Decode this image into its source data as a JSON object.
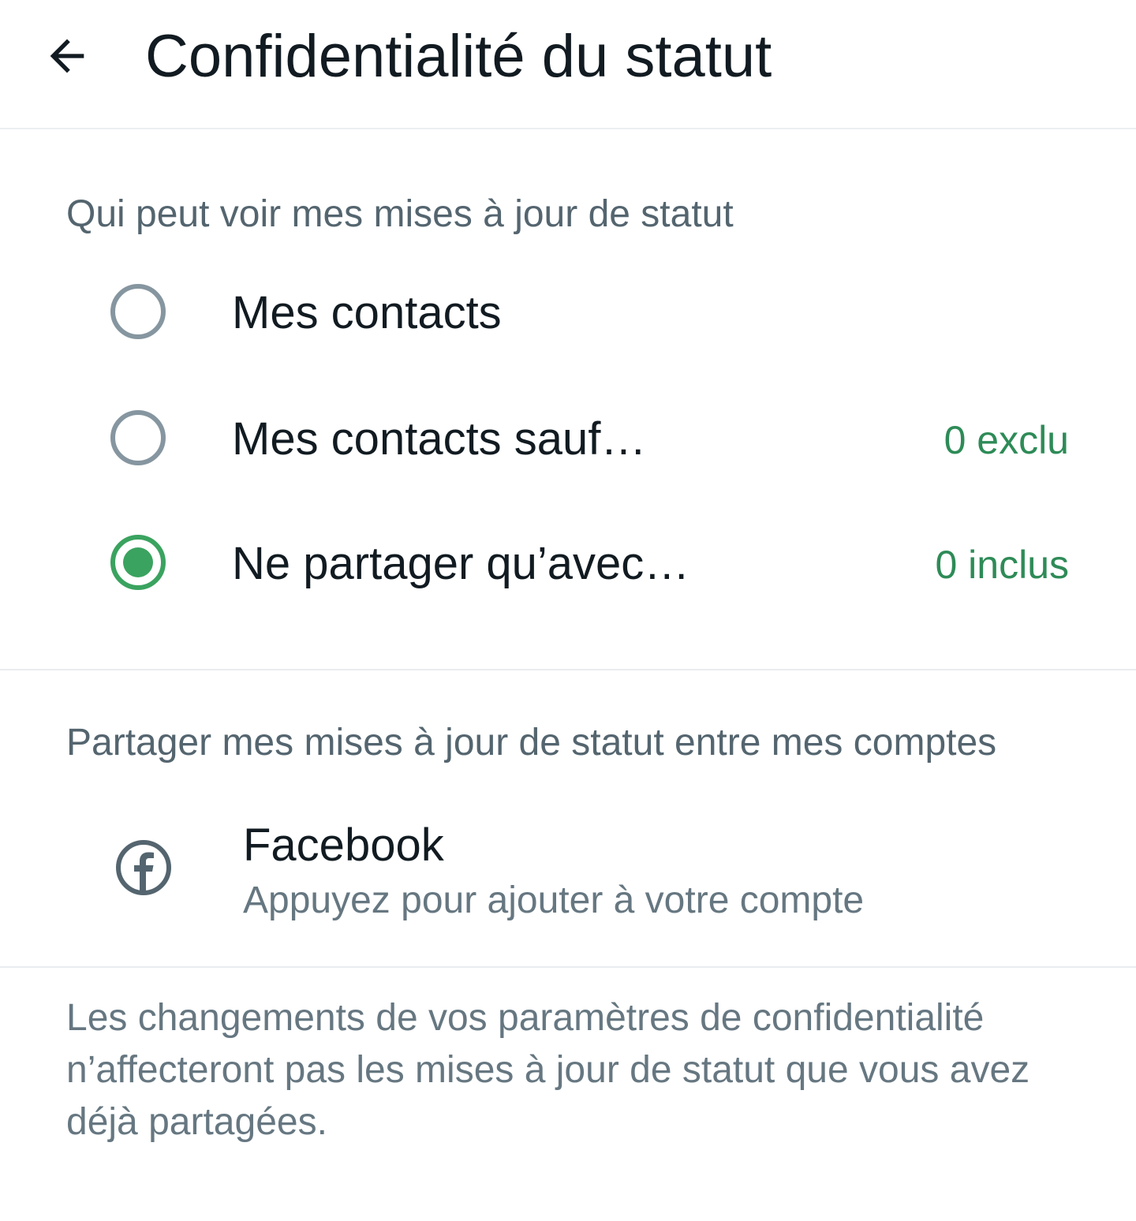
{
  "header": {
    "back_icon": "arrow-left-icon",
    "title": "Confidentialité du statut"
  },
  "visibility_section": {
    "header": "Qui peut voir mes mises à jour de statut",
    "options": [
      {
        "label": "Mes contacts",
        "count": "",
        "selected": false
      },
      {
        "label": "Mes contacts sauf…",
        "count": "0 exclu",
        "selected": false
      },
      {
        "label": "Ne partager qu’avec…",
        "count": "0 inclus",
        "selected": true
      }
    ]
  },
  "share_section": {
    "header": "Partager mes mises à jour de statut entre mes comptes",
    "facebook": {
      "icon": "facebook-icon",
      "title": "Facebook",
      "subtitle": "Appuyez pour ajouter à votre compte"
    }
  },
  "footer": {
    "note": "Les changements de vos paramètres de confidentialité n’affecteront pas les mises à jour de statut que vous avez déjà partagées."
  },
  "colors": {
    "accent": "#3aa35f",
    "count_text": "#2e8b57",
    "radio_off": "#8696a0",
    "secondary_text": "#54656f"
  }
}
